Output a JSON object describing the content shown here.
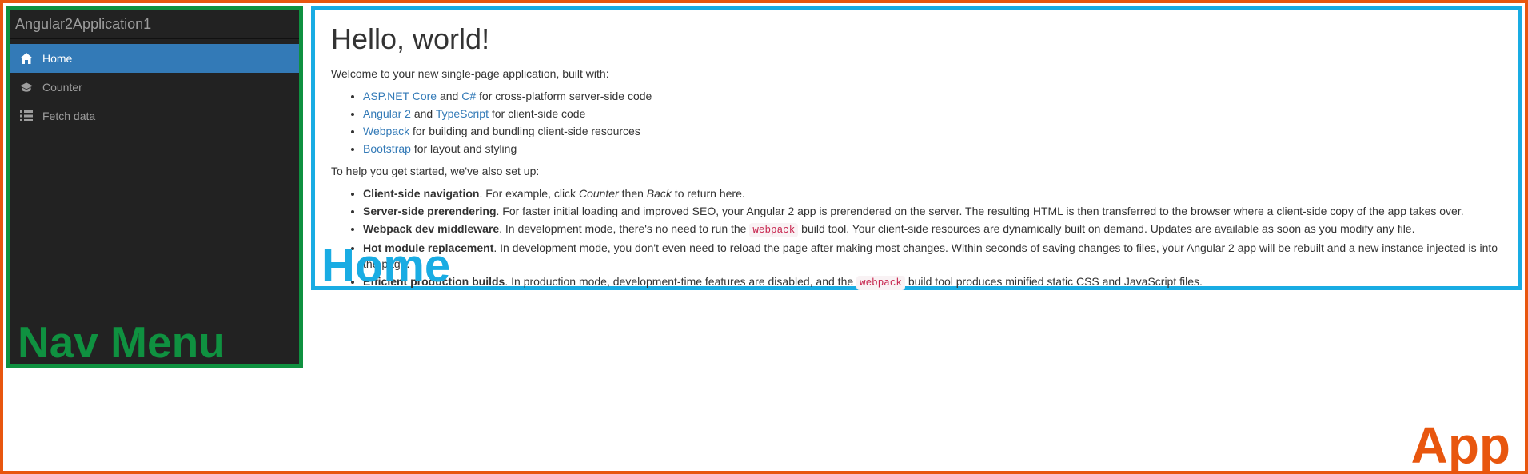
{
  "sidebar": {
    "brand": "Angular2Application1",
    "items": [
      {
        "label": "Home",
        "icon": "home-icon",
        "active": true
      },
      {
        "label": "Counter",
        "icon": "graduation-cap-icon",
        "active": false
      },
      {
        "label": "Fetch data",
        "icon": "list-icon",
        "active": false
      }
    ],
    "annotation": "Nav Menu"
  },
  "main": {
    "heading": "Hello, world!",
    "intro": "Welcome to your new single-page application, built with:",
    "tech": {
      "aspnet": "ASP.NET Core",
      "and1": " and ",
      "csharp": "C#",
      "tech0_rest": " for cross-platform server-side code",
      "angular": "Angular 2",
      "and2": " and ",
      "typescript": "TypeScript",
      "tech1_rest": " for client-side code",
      "webpack": "Webpack",
      "tech2_rest": " for building and bundling client-side resources",
      "bootstrap": "Bootstrap",
      "tech3_rest": " for layout and styling"
    },
    "setup_intro": "To help you get started, we've also set up:",
    "features": {
      "f0_bold": "Client-side navigation",
      "f0_a": ". For example, click ",
      "f0_em1": "Counter",
      "f0_b": " then ",
      "f0_em2": "Back",
      "f0_c": " to return here.",
      "f1_bold": "Server-side prerendering",
      "f1_rest": ". For faster initial loading and improved SEO, your Angular 2 app is prerendered on the server. The resulting HTML is then transferred to the browser where a client-side copy of the app takes over.",
      "f2_bold": "Webpack dev middleware",
      "f2_a": ". In development mode, there's no need to run the ",
      "f2_code": "webpack",
      "f2_b": " build tool. Your client-side resources are dynamically built on demand. Updates are available as soon as you modify any file.",
      "f3_bold": "Hot module replacement",
      "f3_rest": ". In development mode, you don't even need to reload the page after making most changes. Within seconds of saving changes to files, your Angular 2 app will be rebuilt and a new instance injected is into the page.",
      "f4_bold": "Efficient production builds",
      "f4_a": ". In production mode, development-time features are disabled, and the ",
      "f4_code": "webpack",
      "f4_b": " build tool produces minified static CSS and JavaScript files."
    },
    "annotation": "Home"
  },
  "app": {
    "annotation": "App"
  }
}
